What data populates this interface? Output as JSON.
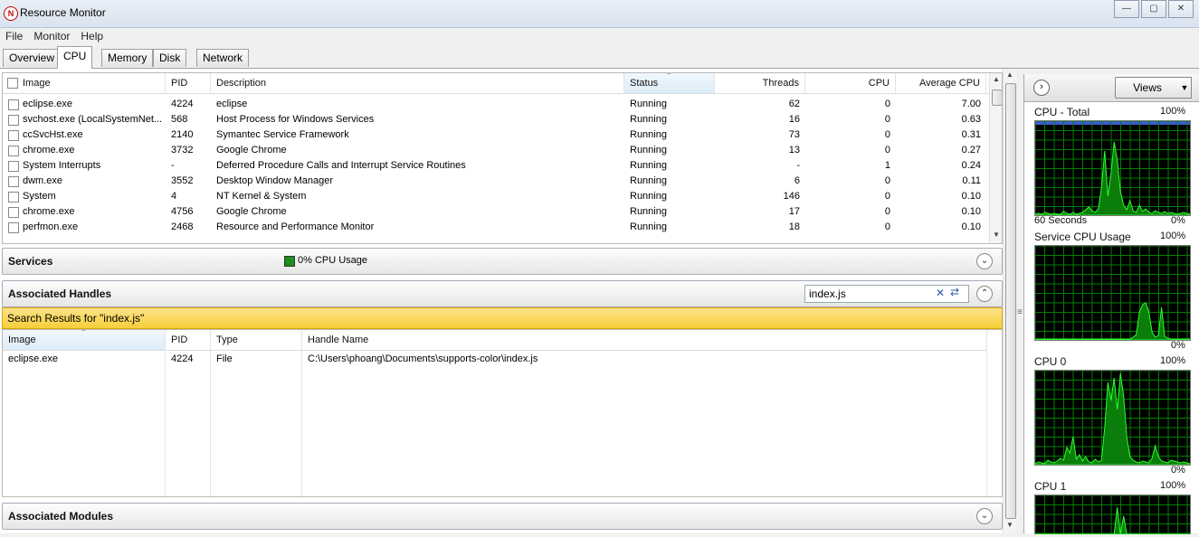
{
  "window": {
    "title": "Resource Monitor",
    "controls": [
      "—",
      "▢",
      "✕"
    ]
  },
  "menu": [
    "File",
    "Monitor",
    "Help"
  ],
  "tabs": [
    "Overview",
    "CPU",
    "Memory",
    "Disk",
    "Network"
  ],
  "processes": {
    "columns": [
      "Image",
      "PID",
      "Description",
      "Status",
      "Threads",
      "CPU",
      "Average CPU"
    ],
    "rows": [
      {
        "image": "eclipse.exe",
        "pid": "4224",
        "desc": "eclipse",
        "status": "Running",
        "threads": "62",
        "cpu": "0",
        "avg": "7.00"
      },
      {
        "image": "svchost.exe (LocalSystemNet...",
        "pid": "568",
        "desc": "Host Process for Windows Services",
        "status": "Running",
        "threads": "16",
        "cpu": "0",
        "avg": "0.63"
      },
      {
        "image": "ccSvcHst.exe",
        "pid": "2140",
        "desc": "Symantec Service Framework",
        "status": "Running",
        "threads": "73",
        "cpu": "0",
        "avg": "0.31"
      },
      {
        "image": "chrome.exe",
        "pid": "3732",
        "desc": "Google Chrome",
        "status": "Running",
        "threads": "13",
        "cpu": "0",
        "avg": "0.27"
      },
      {
        "image": "System Interrupts",
        "pid": "-",
        "desc": "Deferred Procedure Calls and Interrupt Service Routines",
        "status": "Running",
        "threads": "-",
        "cpu": "1",
        "avg": "0.24"
      },
      {
        "image": "dwm.exe",
        "pid": "3552",
        "desc": "Desktop Window Manager",
        "status": "Running",
        "threads": "6",
        "cpu": "0",
        "avg": "0.11"
      },
      {
        "image": "System",
        "pid": "4",
        "desc": "NT Kernel & System",
        "status": "Running",
        "threads": "146",
        "cpu": "0",
        "avg": "0.10"
      },
      {
        "image": "chrome.exe",
        "pid": "4756",
        "desc": "Google Chrome",
        "status": "Running",
        "threads": "17",
        "cpu": "0",
        "avg": "0.10"
      },
      {
        "image": "perfmon.exe",
        "pid": "2468",
        "desc": "Resource and Performance Monitor",
        "status": "Running",
        "threads": "18",
        "cpu": "0",
        "avg": "0.10"
      }
    ]
  },
  "services": {
    "title": "Services",
    "usage": "0% CPU Usage"
  },
  "handles": {
    "title": "Associated Handles",
    "search_value": "index.js",
    "search_results": "Search Results for \"index.js\"",
    "columns": [
      "Image",
      "PID",
      "Type",
      "Handle Name"
    ],
    "rows": [
      {
        "image": "eclipse.exe",
        "pid": "4224",
        "type": "File",
        "name": "C:\\Users\\phoang\\Documents\\supports-color\\index.js"
      }
    ]
  },
  "modules": {
    "title": "Associated Modules"
  },
  "right_pane": {
    "views_label": "Views",
    "graphs": [
      {
        "title": "CPU - Total",
        "top_pct": "100%",
        "bottom_left": "60 Seconds",
        "bottom_pct": "0%"
      },
      {
        "title": "Service CPU Usage",
        "top_pct": "100%",
        "bottom_pct": "0%"
      },
      {
        "title": "CPU 0",
        "top_pct": "100%",
        "bottom_pct": "0%"
      },
      {
        "title": "CPU 1",
        "top_pct": "100%"
      }
    ]
  },
  "colors": {
    "accent_search": "#f7cf3a",
    "graph_green": "#00c800",
    "graph_grid": "#008000"
  }
}
